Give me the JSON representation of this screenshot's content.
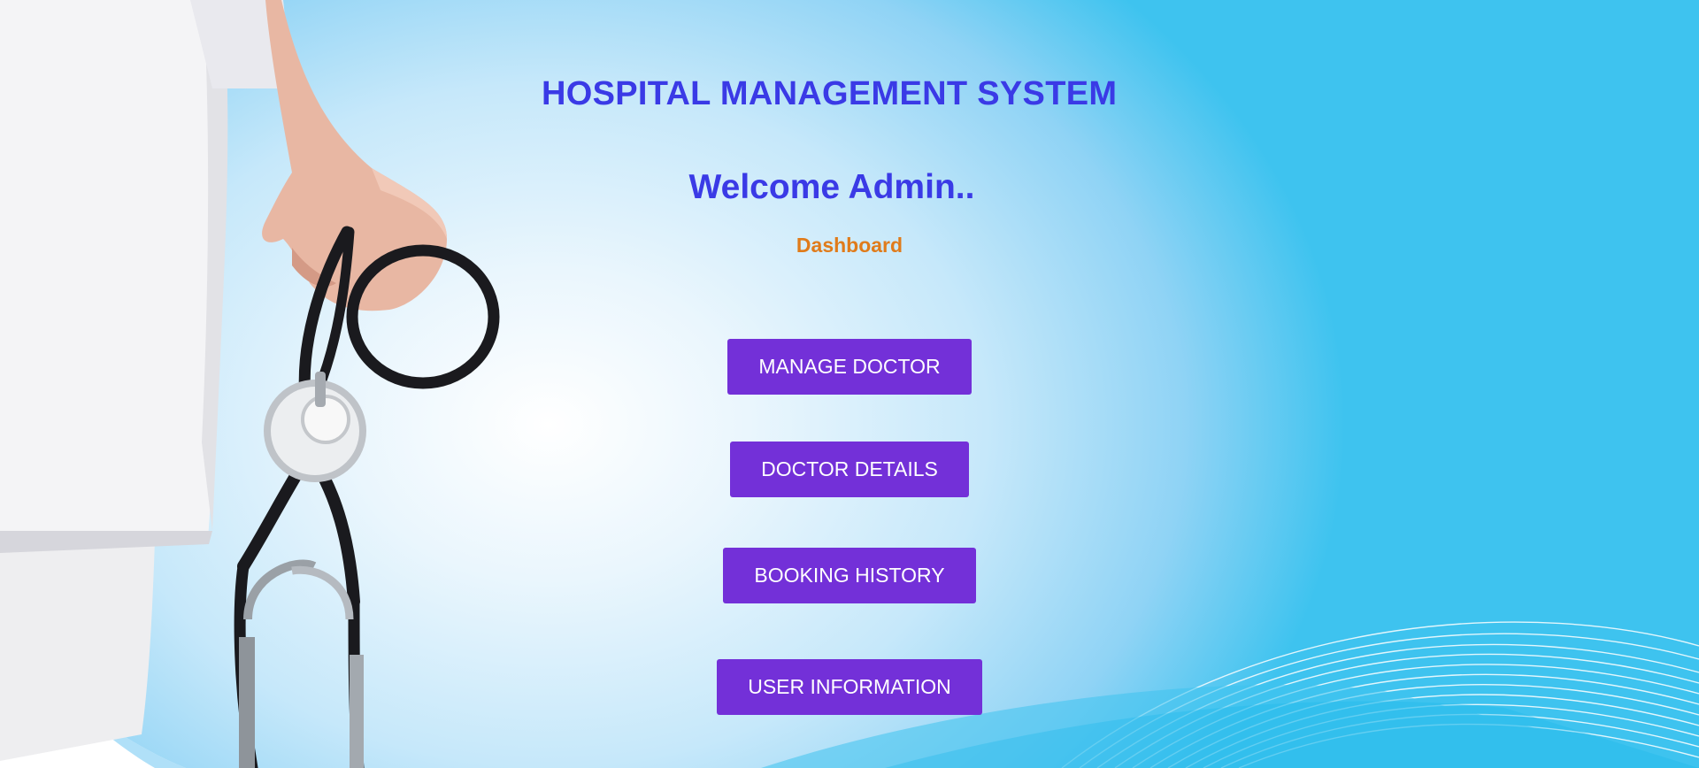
{
  "header": {
    "title": "HOSPITAL MANAGEMENT SYSTEM",
    "welcome": "Welcome Admin..",
    "subtitle": "Dashboard"
  },
  "menu": {
    "buttons": [
      {
        "label": "MANAGE DOCTOR"
      },
      {
        "label": "DOCTOR DETAILS"
      },
      {
        "label": "BOOKING HISTORY"
      },
      {
        "label": "USER INFORMATION"
      }
    ]
  },
  "colors": {
    "title": "#3a3ae6",
    "subtitle": "#e07b1a",
    "button": "#7330d8",
    "button_text": "#ffffff",
    "background_accent": "#3ec3ef"
  }
}
